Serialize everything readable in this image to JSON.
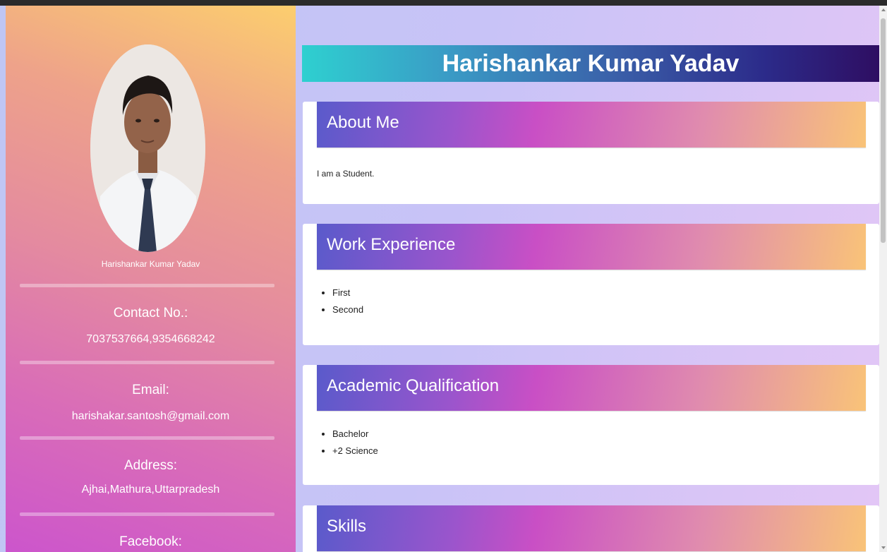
{
  "profile": {
    "name": "Harishankar Kumar Yadav",
    "photo_icon": "profile-photo"
  },
  "contact": {
    "phone_label": "Contact No.:",
    "phone_value": "7037537664,9354668242",
    "email_label": "Email:",
    "email_value": "harishakar.santosh@gmail.com",
    "address_label": "Address:",
    "address_value": "Ajhai,Mathura,Uttarpradesh",
    "facebook_label": "Facebook:"
  },
  "main": {
    "title": "Harishankar Kumar Yadav",
    "sections": {
      "about": {
        "title": "About Me",
        "text": "I am a Student."
      },
      "work": {
        "title": "Work Experience",
        "items": [
          "First",
          "Second"
        ]
      },
      "academic": {
        "title": "Academic Qualification",
        "items": [
          "Bachelor",
          "+2 Science"
        ]
      },
      "skills": {
        "title": "Skills"
      }
    }
  },
  "colors": {
    "sidebar_gradient": [
      "#fcce6e",
      "#e48b9f",
      "#cc55cc"
    ],
    "title_gradient": [
      "#2ed0d0",
      "#2c2b8a",
      "#2e0e62"
    ],
    "section_head_gradient": [
      "#5a5acb",
      "#c94fc5",
      "#f9c378"
    ]
  }
}
